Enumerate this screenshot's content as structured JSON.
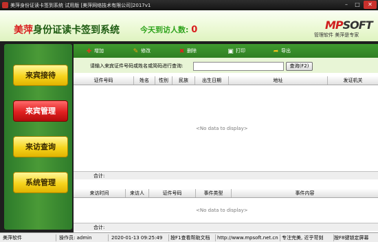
{
  "window": {
    "title": "美萍身份证读卡签到系统 试用版 [美萍网络技术有限公司]2017v1",
    "min": "–",
    "max": "□",
    "close": "✕"
  },
  "header": {
    "title_highlight": "美萍",
    "title_rest": "身份证读卡签到系统",
    "visitors_label": "今天到访人数:",
    "visitors_count": "0",
    "brand_mp": "MP",
    "brand_soft": "SOFT",
    "slogan": "管理软件 美萍是专家"
  },
  "sidebar": {
    "items": [
      {
        "label": "来宾接待",
        "active": false
      },
      {
        "label": "来宾管理",
        "active": true
      },
      {
        "label": "来访查询",
        "active": false
      },
      {
        "label": "系统管理",
        "active": false
      }
    ]
  },
  "toolbar": {
    "add": {
      "label": "增加",
      "icon": "add-icon",
      "glyph": "✚",
      "color": "#e03b1f"
    },
    "edit": {
      "label": "修改",
      "icon": "edit-icon",
      "glyph": "✎",
      "color": "#f1a010"
    },
    "delete": {
      "label": "删除",
      "icon": "delete-icon",
      "glyph": "✖",
      "color": "#e02020"
    },
    "print": {
      "label": "打印",
      "icon": "print-icon",
      "glyph": "▣",
      "color": "#ffffff"
    },
    "export": {
      "label": "导出",
      "icon": "export-icon",
      "glyph": "➦",
      "color": "#f6c21a"
    }
  },
  "search": {
    "label": "请输入来宾证件号码或姓名或简码进行查询:",
    "value": "",
    "button": "查询(F2)"
  },
  "guest_table": {
    "columns": [
      "证件号码",
      "姓名",
      "性别",
      "民族",
      "出生日期",
      "地址",
      "发证机关"
    ],
    "empty_text": "<No data to display>",
    "total_label": "合计:"
  },
  "event_table": {
    "columns": [
      "来访时间",
      "来访人",
      "证件号码",
      "事件类型",
      "事件内容"
    ],
    "empty_text": "<No data to display>",
    "total_label": "合计:"
  },
  "statusbar": {
    "company": "美萍软件",
    "operator": "操作员: admin",
    "datetime": "2020-01-13 09:25:49",
    "help": "按F1查看帮助文档",
    "url": "http://www.mpsoft.net.cn",
    "tip1": "专注完美, 近乎苛刻",
    "tip2": "按F8键锁定屏幕"
  },
  "colors": {
    "brand_red": "#d81e1e",
    "brand_green": "#2f7f22",
    "button_yellow": "#f6d41d"
  }
}
